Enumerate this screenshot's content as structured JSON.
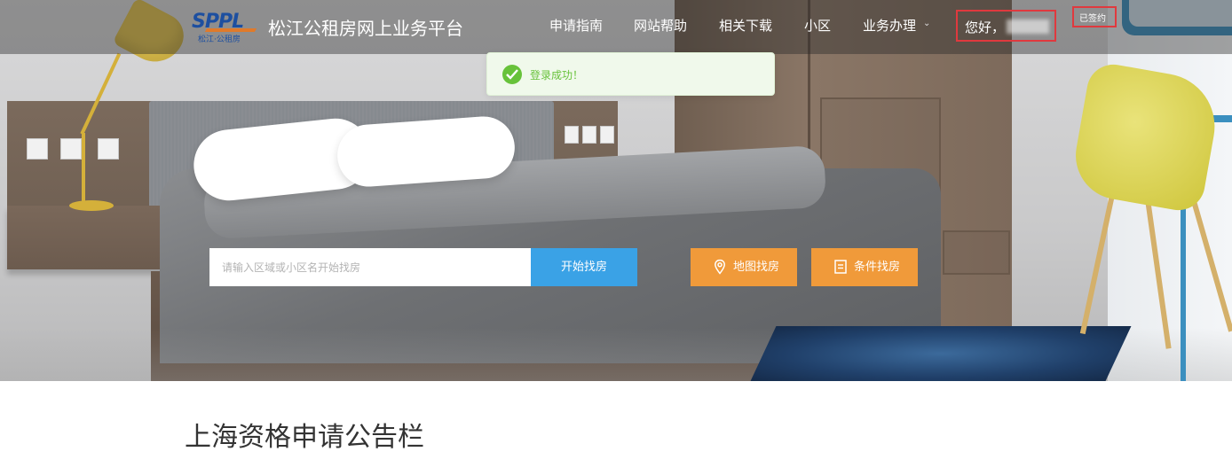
{
  "header": {
    "logo_mark": "SPPL",
    "logo_sub": "松江·公租房",
    "site_title": "松江公租房网上业务平台",
    "nav": [
      {
        "label": "申请指南"
      },
      {
        "label": "网站帮助"
      },
      {
        "label": "相关下载"
      },
      {
        "label": "小区"
      },
      {
        "label": "业务办理"
      }
    ],
    "greeting": "您好，",
    "signed_badge": "已签约"
  },
  "toast": {
    "message": "登录成功！",
    "icon": "check-circle-icon",
    "color": "#67c23a"
  },
  "search": {
    "placeholder": "请输入区域或小区名开始找房",
    "value": "",
    "button_label": "开始找房",
    "map_button_label": "地图找房",
    "filter_button_label": "条件找房",
    "button_color": "#3aa2e6",
    "orange_color": "#f09a3a"
  },
  "section": {
    "title": "上海资格申请公告栏"
  }
}
